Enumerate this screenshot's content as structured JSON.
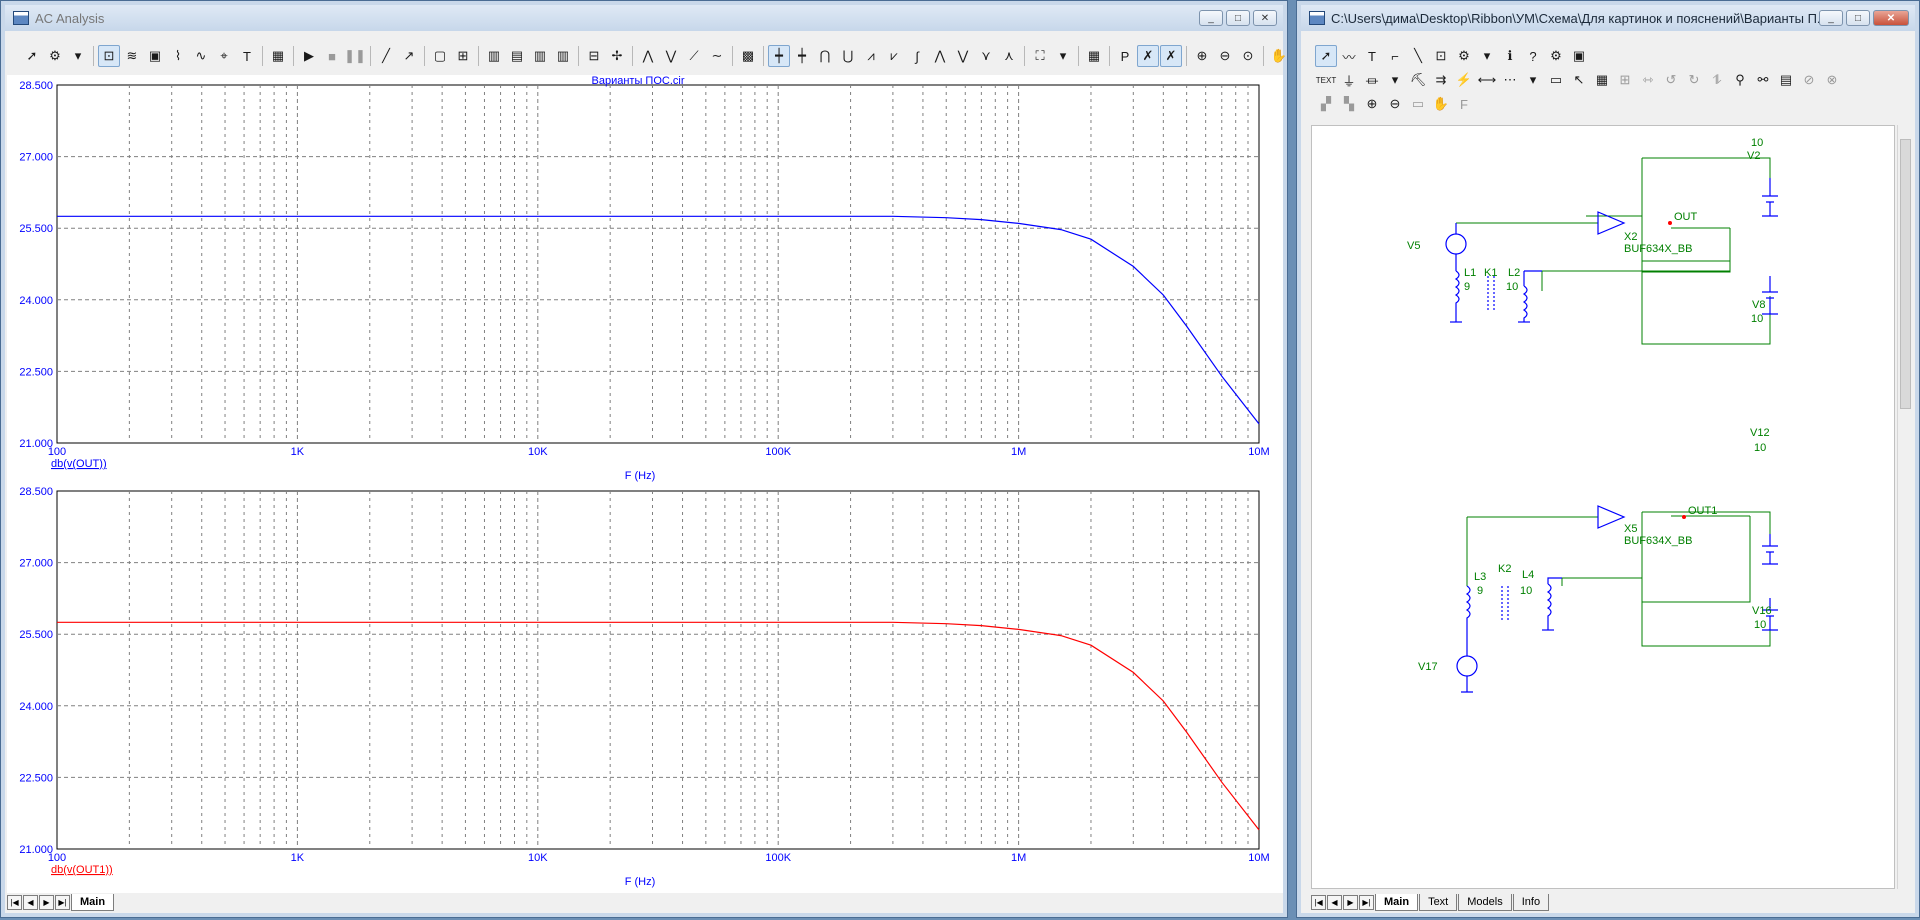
{
  "ac_window": {
    "title": "AC Analysis",
    "buttons": {
      "minimize": "_",
      "maximize": "□",
      "close": "✕"
    },
    "plot_title": "Варианты ПОС.cir",
    "tabs": {
      "main": "Main"
    }
  },
  "schematic_window": {
    "title": "C:\\Users\\дима\\Desktop\\Ribbon\\УМ\\Схема\\Для картинок и пояснений\\Варианты П...",
    "buttons": {
      "minimize": "_",
      "maximize": "□",
      "close": "✕"
    },
    "tabs": {
      "main": "Main",
      "text": "Text",
      "models": "Models",
      "info": "Info"
    },
    "labels": {
      "v2": "V2",
      "v2_val": "10",
      "v5": "V5",
      "v8": "V8",
      "v8_val": "10",
      "x2": "X2",
      "x2_model": "BUF634X_BB",
      "out": "OUT",
      "l1": "L1",
      "l1_val": "9",
      "k1": "K1",
      "l2": "L2",
      "l2_val": "10",
      "v12": "V12",
      "v12_val": "10",
      "x5": "X5",
      "x5_model": "BUF634X_BB",
      "out1": "OUT1",
      "l3": "L3",
      "l3_val": "9",
      "k2": "K2",
      "l4": "L4",
      "l4_val": "10",
      "v16": "V16",
      "v16_val": "10",
      "v17": "V17"
    }
  },
  "chart_data": [
    {
      "type": "line",
      "title": "Варианты ПОС.cir",
      "xlabel": "F (Hz)",
      "xscale": "log",
      "xlim": [
        100,
        10000000
      ],
      "ylim": [
        21.0,
        28.5
      ],
      "x_ticks": [
        "100",
        "1K",
        "10K",
        "100K",
        "1M",
        "10M"
      ],
      "y_ticks": [
        "28.500",
        "27.000",
        "25.500",
        "24.000",
        "22.500",
        "21.000"
      ],
      "grid": true,
      "series": [
        {
          "name": "db(v(OUT))",
          "color": "#0000ff",
          "x": [
            100,
            1000,
            10000,
            100000,
            300000,
            500000,
            700000,
            1000000,
            1500000,
            2000000,
            3000000,
            4000000,
            5000000,
            7000000,
            10000000
          ],
          "y": [
            25.75,
            25.75,
            25.75,
            25.75,
            25.75,
            25.72,
            25.68,
            25.6,
            25.47,
            25.27,
            24.7,
            24.1,
            23.45,
            22.4,
            21.4
          ]
        }
      ]
    },
    {
      "type": "line",
      "xlabel": "F (Hz)",
      "xscale": "log",
      "xlim": [
        100,
        10000000
      ],
      "ylim": [
        21.0,
        28.5
      ],
      "x_ticks": [
        "100",
        "1K",
        "10K",
        "100K",
        "1M",
        "10M"
      ],
      "y_ticks": [
        "28.500",
        "27.000",
        "25.500",
        "24.000",
        "22.500",
        "21.000"
      ],
      "grid": true,
      "series": [
        {
          "name": "db(v(OUT1))",
          "color": "#ff0000",
          "x": [
            100,
            1000,
            10000,
            100000,
            300000,
            500000,
            700000,
            1000000,
            1500000,
            2000000,
            3000000,
            4000000,
            5000000,
            7000000,
            10000000
          ],
          "y": [
            25.75,
            25.75,
            25.75,
            25.75,
            25.75,
            25.72,
            25.68,
            25.6,
            25.47,
            25.27,
            24.7,
            24.1,
            23.45,
            22.4,
            21.4
          ]
        }
      ]
    }
  ]
}
